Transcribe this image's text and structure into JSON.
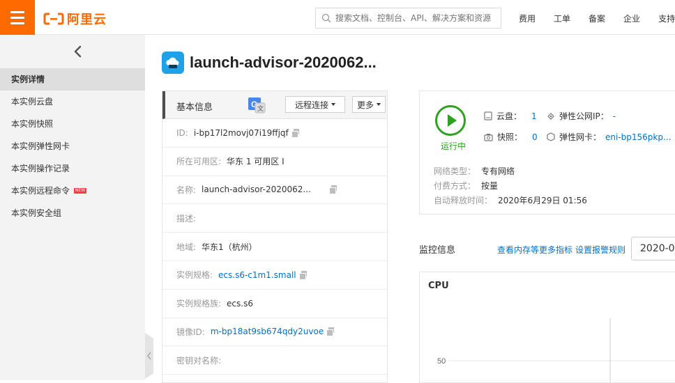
{
  "header": {
    "logo_text": "阿里云",
    "search_placeholder": "搜索文档、控制台、API、解决方案和资源",
    "nav": [
      "费用",
      "工单",
      "备案",
      "企业",
      "支持"
    ]
  },
  "sidebar": {
    "items": [
      {
        "label": "实例详情",
        "active": true
      },
      {
        "label": "本实例云盘"
      },
      {
        "label": "本实例快照"
      },
      {
        "label": "本实例弹性网卡"
      },
      {
        "label": "本实例操作记录"
      },
      {
        "label": "本实例远程命令",
        "badge": "NEW"
      },
      {
        "label": "本实例安全组"
      }
    ]
  },
  "page": {
    "title": "launch-advisor-2020062..."
  },
  "basic_info": {
    "title": "基本信息",
    "remote_btn": "远程连接",
    "more_btn": "更多",
    "rows": [
      {
        "label": "ID:",
        "value": "i-bp17l2movj07i19ffjqf"
      },
      {
        "label": "所在可用区:",
        "value": "华东 1 可用区 I"
      },
      {
        "label": "名称:",
        "value": "launch-advisor-2020062..."
      },
      {
        "label": "描述:",
        "value": ""
      },
      {
        "label": "地域:",
        "value": "华东1（杭州）"
      },
      {
        "label": "实例规格:",
        "value": "ecs.s6-c1m1.small"
      },
      {
        "label": "实例规格族:",
        "value": "ecs.s6"
      },
      {
        "label": "镜像ID:",
        "value": "m-bp18at9sb674qdy2uvoe"
      },
      {
        "label": "密钥对名称:",
        "value": ""
      }
    ]
  },
  "status": {
    "state": "运行中",
    "disk_label": "云盘：",
    "disk_count": "1",
    "snapshot_label": "快照：",
    "snapshot_count": "0",
    "eip_label": "弹性公网IP：",
    "eip_value": "-",
    "eni_label": "弹性网卡：",
    "eni_value": "eni-bp156pkp...",
    "network_type_label": "网络类型：",
    "network_type": "专有网络",
    "billing_label": "付费方式：",
    "billing": "按量",
    "release_label": "自动释放时间：",
    "release_time": "2020年6月29日 01:56"
  },
  "monitor": {
    "title": "监控信息",
    "link_more": "查看内存等更多指标",
    "link_alert": "设置报警规则",
    "date": "2020-0"
  },
  "chart_data": {
    "type": "line",
    "title": "CPU",
    "ytick_visible": "50"
  },
  "colors": {
    "brand": "#ff6a00",
    "link": "#0070cc",
    "running": "#2ea121"
  }
}
